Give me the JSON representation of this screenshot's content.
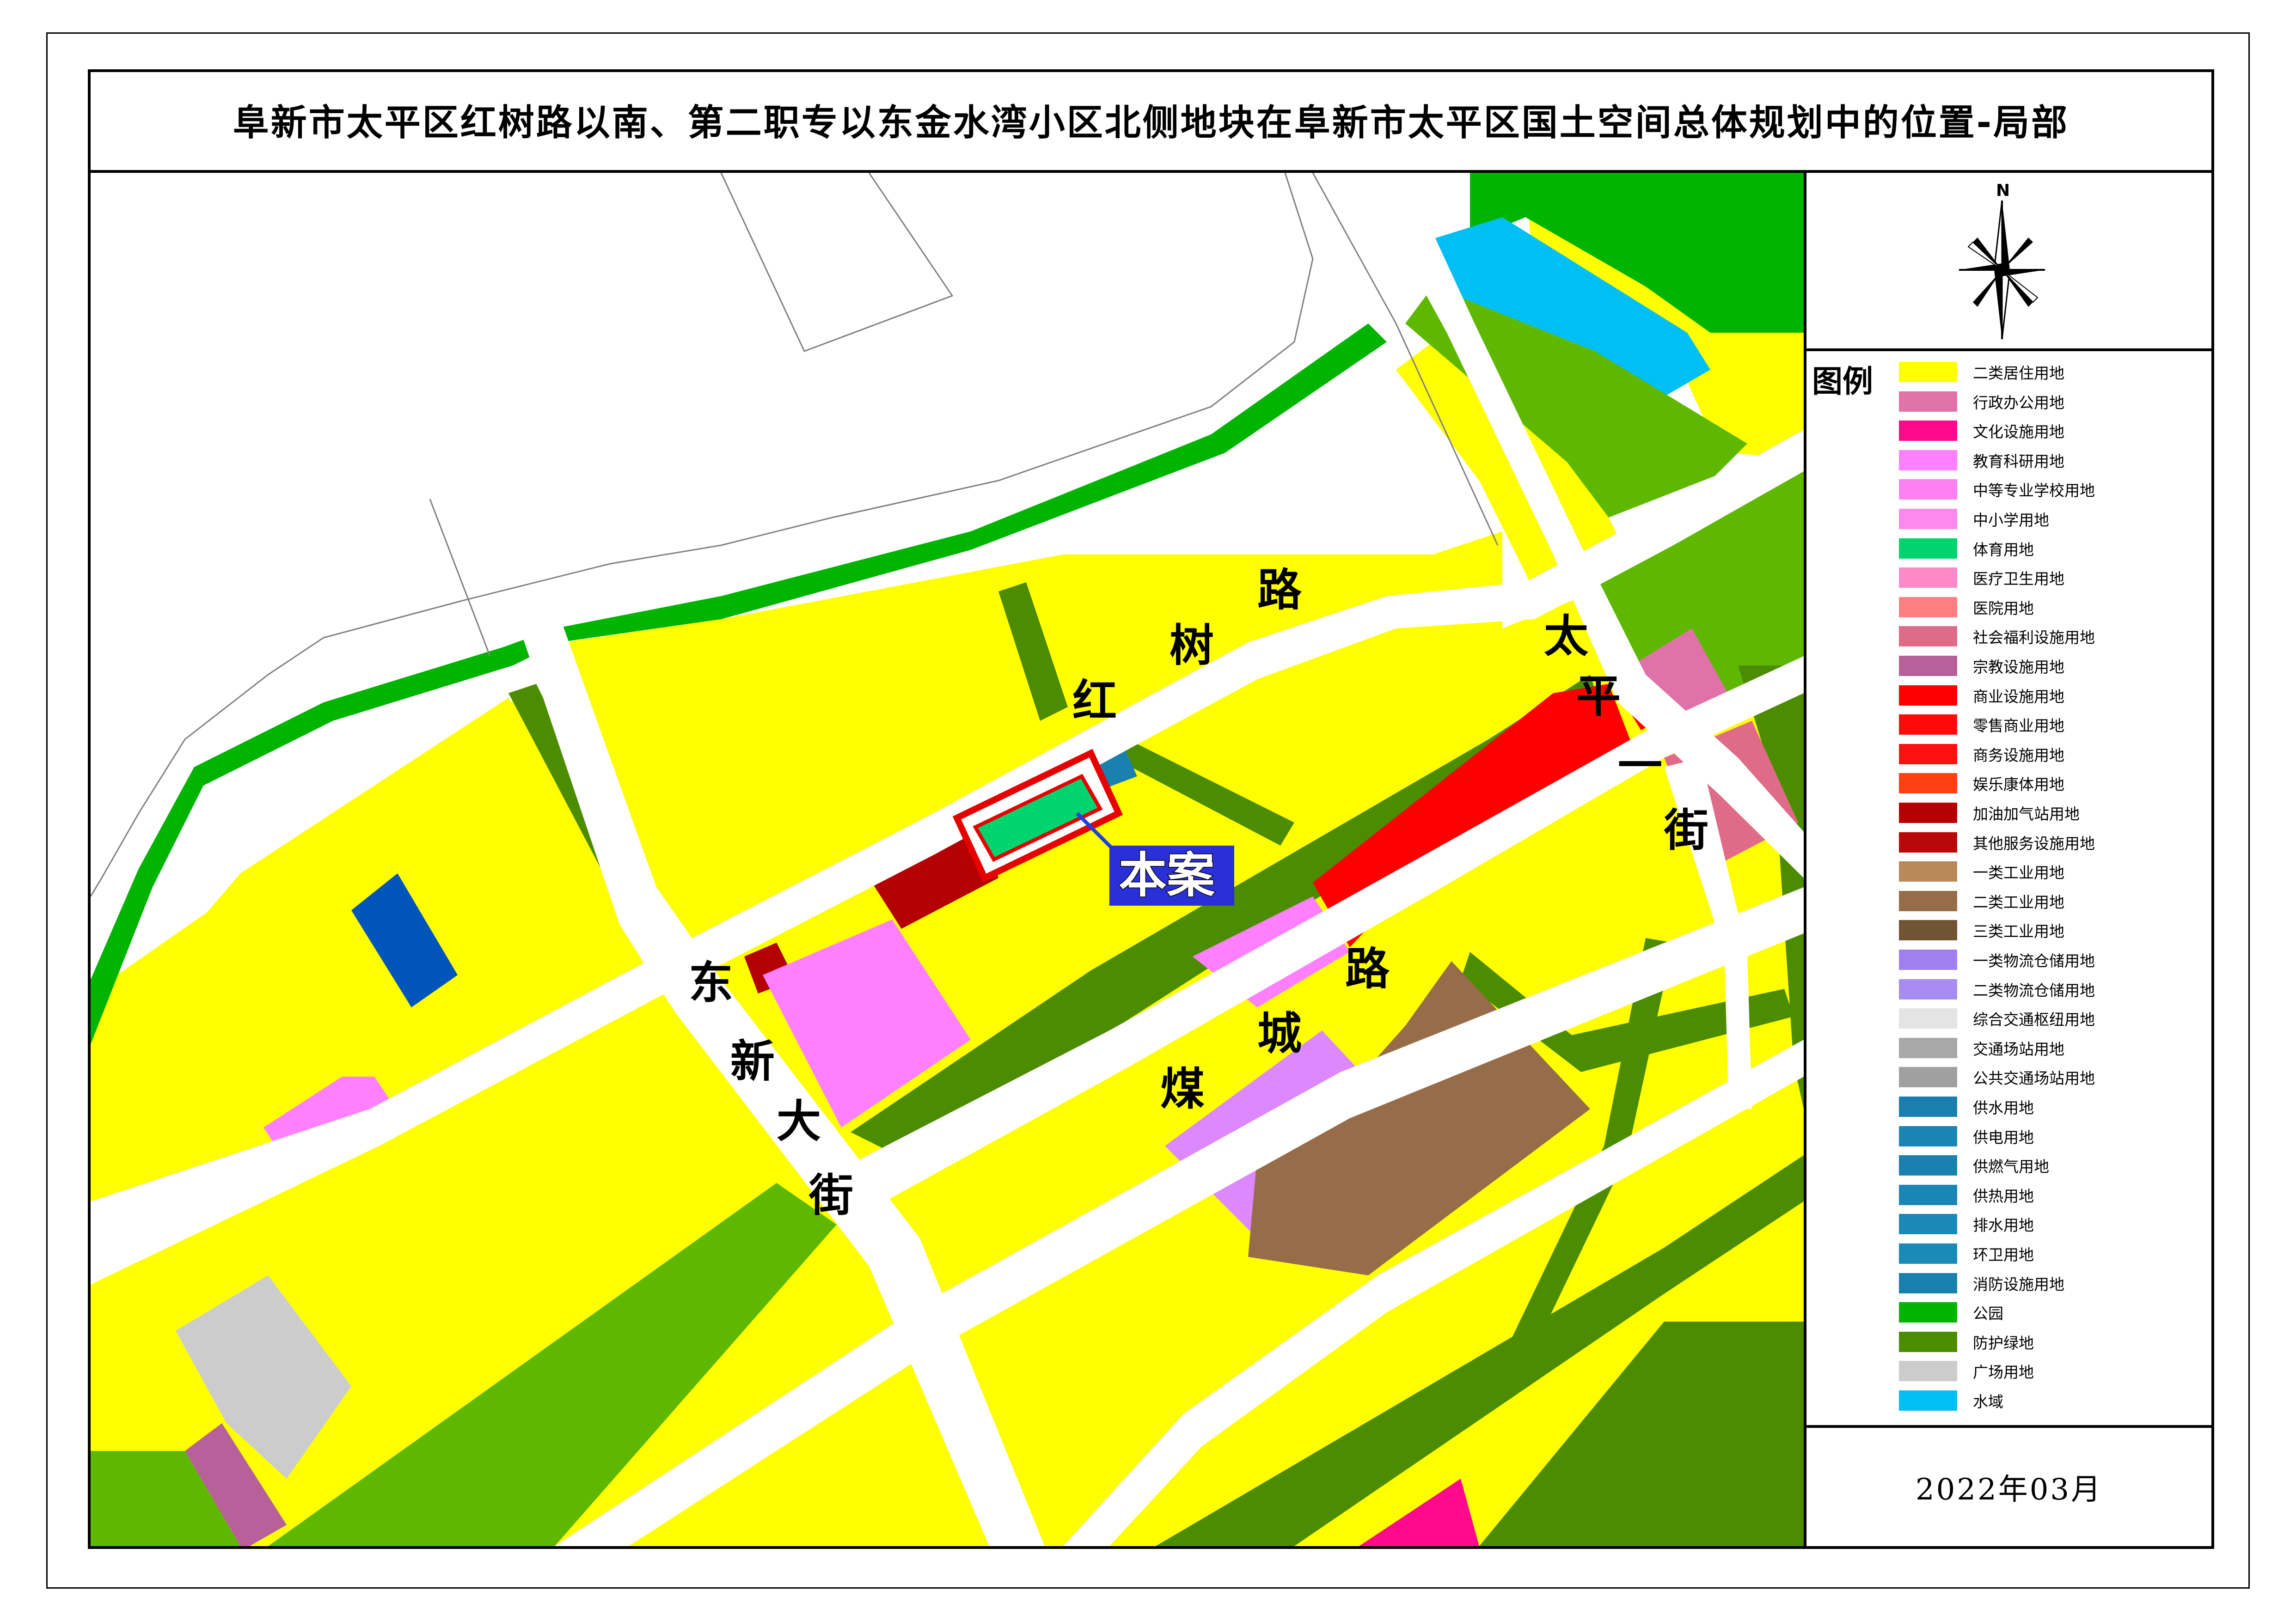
{
  "title": "阜新市太平区红树路以南、第二职专以东金水湾小区北侧地块在阜新市太平区国土空间总体规划中的位置-局部",
  "compass": {
    "north_label": "N"
  },
  "legend": {
    "title": "图例",
    "items": [
      {
        "label": "二类居住用地",
        "color": "#ffff00"
      },
      {
        "label": "行政办公用地",
        "color": "#e072a8"
      },
      {
        "label": "文化设施用地",
        "color": "#ff0a8c"
      },
      {
        "label": "教育科研用地",
        "color": "#ff80ff"
      },
      {
        "label": "中等专业学校用地",
        "color": "#ff80f0"
      },
      {
        "label": "中小学用地",
        "color": "#ff88ee"
      },
      {
        "label": "体育用地",
        "color": "#00d46e"
      },
      {
        "label": "医疗卫生用地",
        "color": "#ff88c8"
      },
      {
        "label": "医院用地",
        "color": "#ff8080"
      },
      {
        "label": "社会福利设施用地",
        "color": "#e06b88"
      },
      {
        "label": "宗教设施用地",
        "color": "#b8609a"
      },
      {
        "label": "商业设施用地",
        "color": "#ff0000"
      },
      {
        "label": "零售商业用地",
        "color": "#ff0a0a"
      },
      {
        "label": "商务设施用地",
        "color": "#ff1010"
      },
      {
        "label": "娱乐康体用地",
        "color": "#ff4010"
      },
      {
        "label": "加油加气站用地",
        "color": "#b40000"
      },
      {
        "label": "其他服务设施用地",
        "color": "#b80808"
      },
      {
        "label": "一类工业用地",
        "color": "#b88a5a"
      },
      {
        "label": "二类工业用地",
        "color": "#976c48"
      },
      {
        "label": "三类工业用地",
        "color": "#705434"
      },
      {
        "label": "一类物流仓储用地",
        "color": "#a080f0"
      },
      {
        "label": "二类物流仓储用地",
        "color": "#a88cf0"
      },
      {
        "label": "综合交通枢纽用地",
        "color": "#e4e4e4"
      },
      {
        "label": "交通场站用地",
        "color": "#a8a8a8"
      },
      {
        "label": "公共交通场站用地",
        "color": "#a0a0a0"
      },
      {
        "label": "供水用地",
        "color": "#1a7fae"
      },
      {
        "label": "供电用地",
        "color": "#1a84b4"
      },
      {
        "label": "供燃气用地",
        "color": "#1a80b0"
      },
      {
        "label": "供热用地",
        "color": "#1a86b6"
      },
      {
        "label": "排水用地",
        "color": "#1a88b8"
      },
      {
        "label": "环卫用地",
        "color": "#1a8ab8"
      },
      {
        "label": "消防设施用地",
        "color": "#1a80ae"
      },
      {
        "label": "公园",
        "color": "#00b400"
      },
      {
        "label": "防护绿地",
        "color": "#4c8c00"
      },
      {
        "label": "广场用地",
        "color": "#cccccc"
      },
      {
        "label": "水域",
        "color": "#00bff2"
      }
    ]
  },
  "date": "2022年03月",
  "map": {
    "case_label": "本案",
    "roads": {
      "hongshu": [
        "红",
        "树",
        "路"
      ],
      "dongxin": [
        "东",
        "新",
        "大",
        "街"
      ],
      "meicheng": [
        "煤",
        "城",
        "路"
      ],
      "taiping": [
        "太",
        "平",
        "一",
        "街"
      ]
    },
    "colors": {
      "residential": "#ffff00",
      "park": "#00b400",
      "protective_green": "#4c8c00",
      "green_light": "#5fb800",
      "water": "#00bff2",
      "commercial": "#ff0000",
      "gas_station": "#b40000",
      "education": "#ff80ff",
      "logistics": "#dd88ff",
      "industrial": "#976c48",
      "admin": "#e072a8",
      "welfare": "#e06b88",
      "religion": "#b8609a",
      "culture": "#ff0a8c",
      "square": "#cccccc",
      "government": "#0055bb",
      "utility": "#1a80ae",
      "sports": "#00d46e",
      "road": "#ffffff"
    }
  }
}
